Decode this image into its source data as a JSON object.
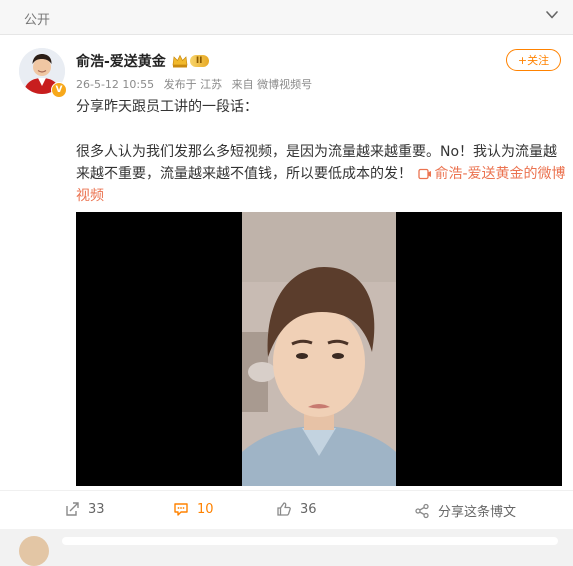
{
  "visibility_label": "公开",
  "post": {
    "author": "俞浩-爱送黄金",
    "verified_badge": "V",
    "level_badge": "II",
    "timestamp": "26-5-12 10:55",
    "location": "发布于 江苏",
    "source": "来自 微博视频号",
    "follow_label": "+关注",
    "text_line1": "分享昨天跟员工讲的一段话：",
    "text_body": "很多人认为我们发那么多短视频，是因为流量越来越重要。No！我认为流量越来越不重要，流量越来越不值钱，所以要低成本的发！",
    "video_link": "俞浩-爱送黄金的微博视频"
  },
  "actions": {
    "share_count": "33",
    "comment_count": "10",
    "like_count": "36",
    "share_longform_label": "分享这条博文"
  },
  "colors": {
    "accent": "#ff8200",
    "link": "#eb7350"
  },
  "icons": [
    "chevron-down-icon",
    "crown-icon",
    "video-link-icon",
    "share-icon",
    "comment-icon",
    "like-icon",
    "share-post-icon"
  ]
}
